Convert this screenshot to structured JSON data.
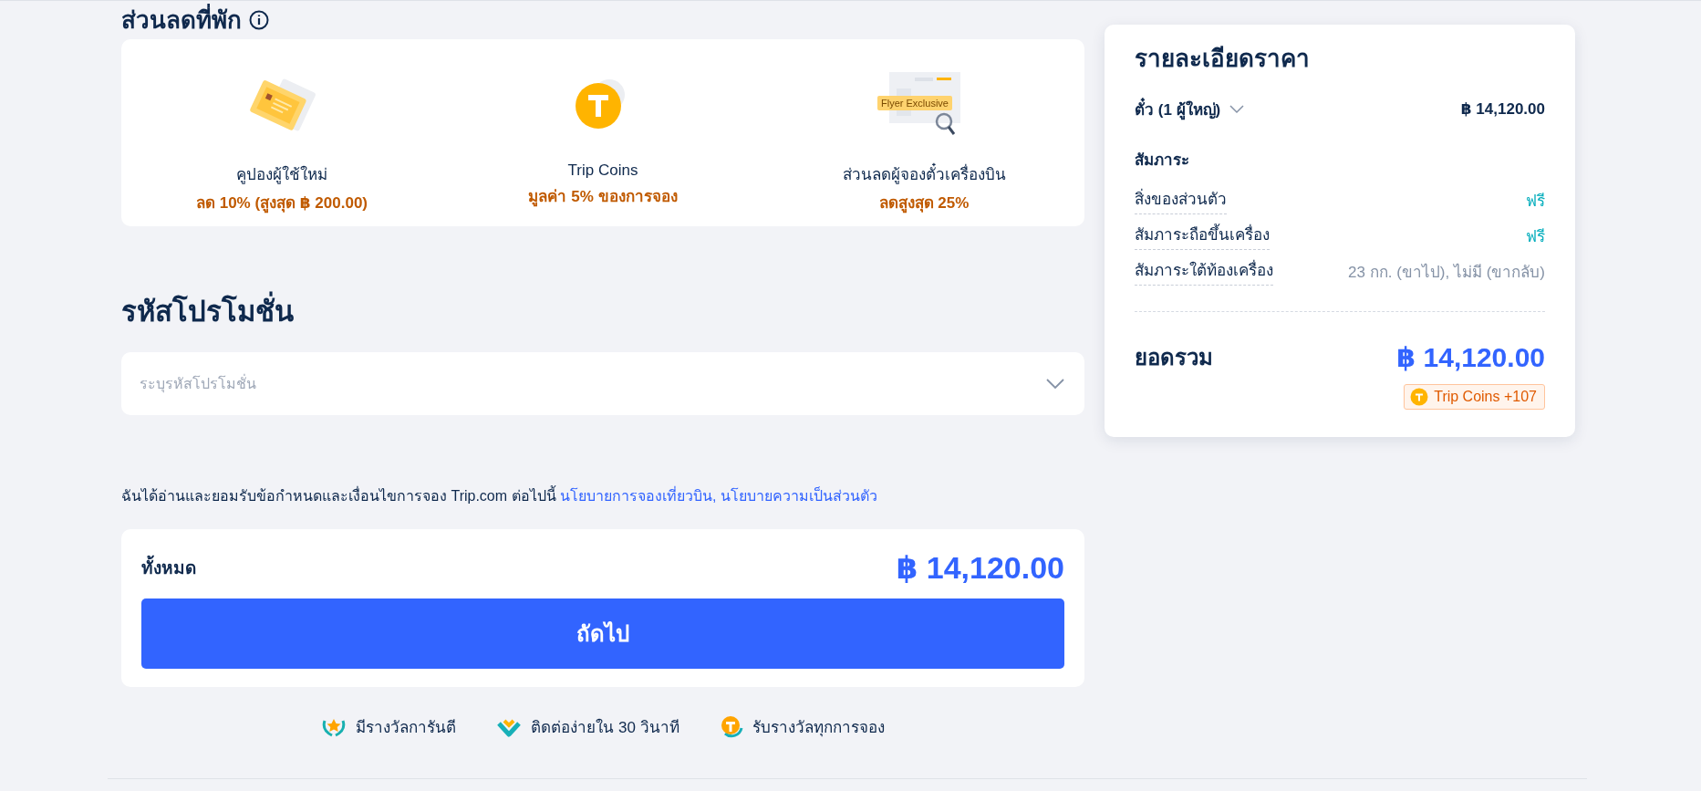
{
  "section_heading": "ส่วนลดที่พัก",
  "benefits": [
    {
      "kind": "coupon",
      "title": "คูปองผู้ใช้ใหม่",
      "value": "ลด 10% (สูงสุด ฿ 200.00)"
    },
    {
      "kind": "coin",
      "title": "Trip Coins",
      "value": "มูลค่า 5% ของการจอง"
    },
    {
      "kind": "flyer",
      "title": "ส่วนลดผู้จองตั๋วเครื่องบิน",
      "value": "ลดสูงสุด 25%",
      "badge": "Flyer Exclusive"
    }
  ],
  "promo": {
    "heading": "รหัสโปรโมชั่น",
    "placeholder": "ระบุรหัสโปรโมชั่น"
  },
  "terms": {
    "text": "ฉันได้อ่านและยอมรับข้อกำหนดและเงื่อนไขการจอง Trip.com ต่อไปนี้",
    "links": [
      "นโยบายการจองเที่ยวบิน,",
      "นโยบายความเป็นส่วนตัว"
    ]
  },
  "total": {
    "label": "ทั้งหมด",
    "amount": "฿ 14,120.00",
    "button": "ถัดไป"
  },
  "features": [
    {
      "kind": "award",
      "text": "มีรางวัลการันตี"
    },
    {
      "kind": "heart",
      "text": "ติดต่อง่ายใน 30 วินาที"
    },
    {
      "kind": "coin",
      "text": "รับรางวัลทุกการจอง"
    }
  ],
  "price_details": {
    "title": "รายละเอียดราคา",
    "ticket_label": "ตั๋ว (1 ผู้ใหญ่)",
    "ticket_amount": "฿ 14,120.00",
    "baggage_heading": "สัมภาระ",
    "baggage": [
      {
        "label": "สิ่งของส่วนตัว",
        "value": "ฟรี",
        "free": true
      },
      {
        "label": "สัมภาระถือขึ้นเครื่อง",
        "value": "ฟรี",
        "free": true
      },
      {
        "label": "สัมภาระใต้ท้องเครื่อง",
        "value": "23 กก. (ขาไป), ไม่มี (ขากลับ)",
        "free": false
      }
    ],
    "total_label": "ยอดรวม",
    "total_amount": "฿ 14,120.00",
    "coins_badge": "Trip Coins +107"
  }
}
